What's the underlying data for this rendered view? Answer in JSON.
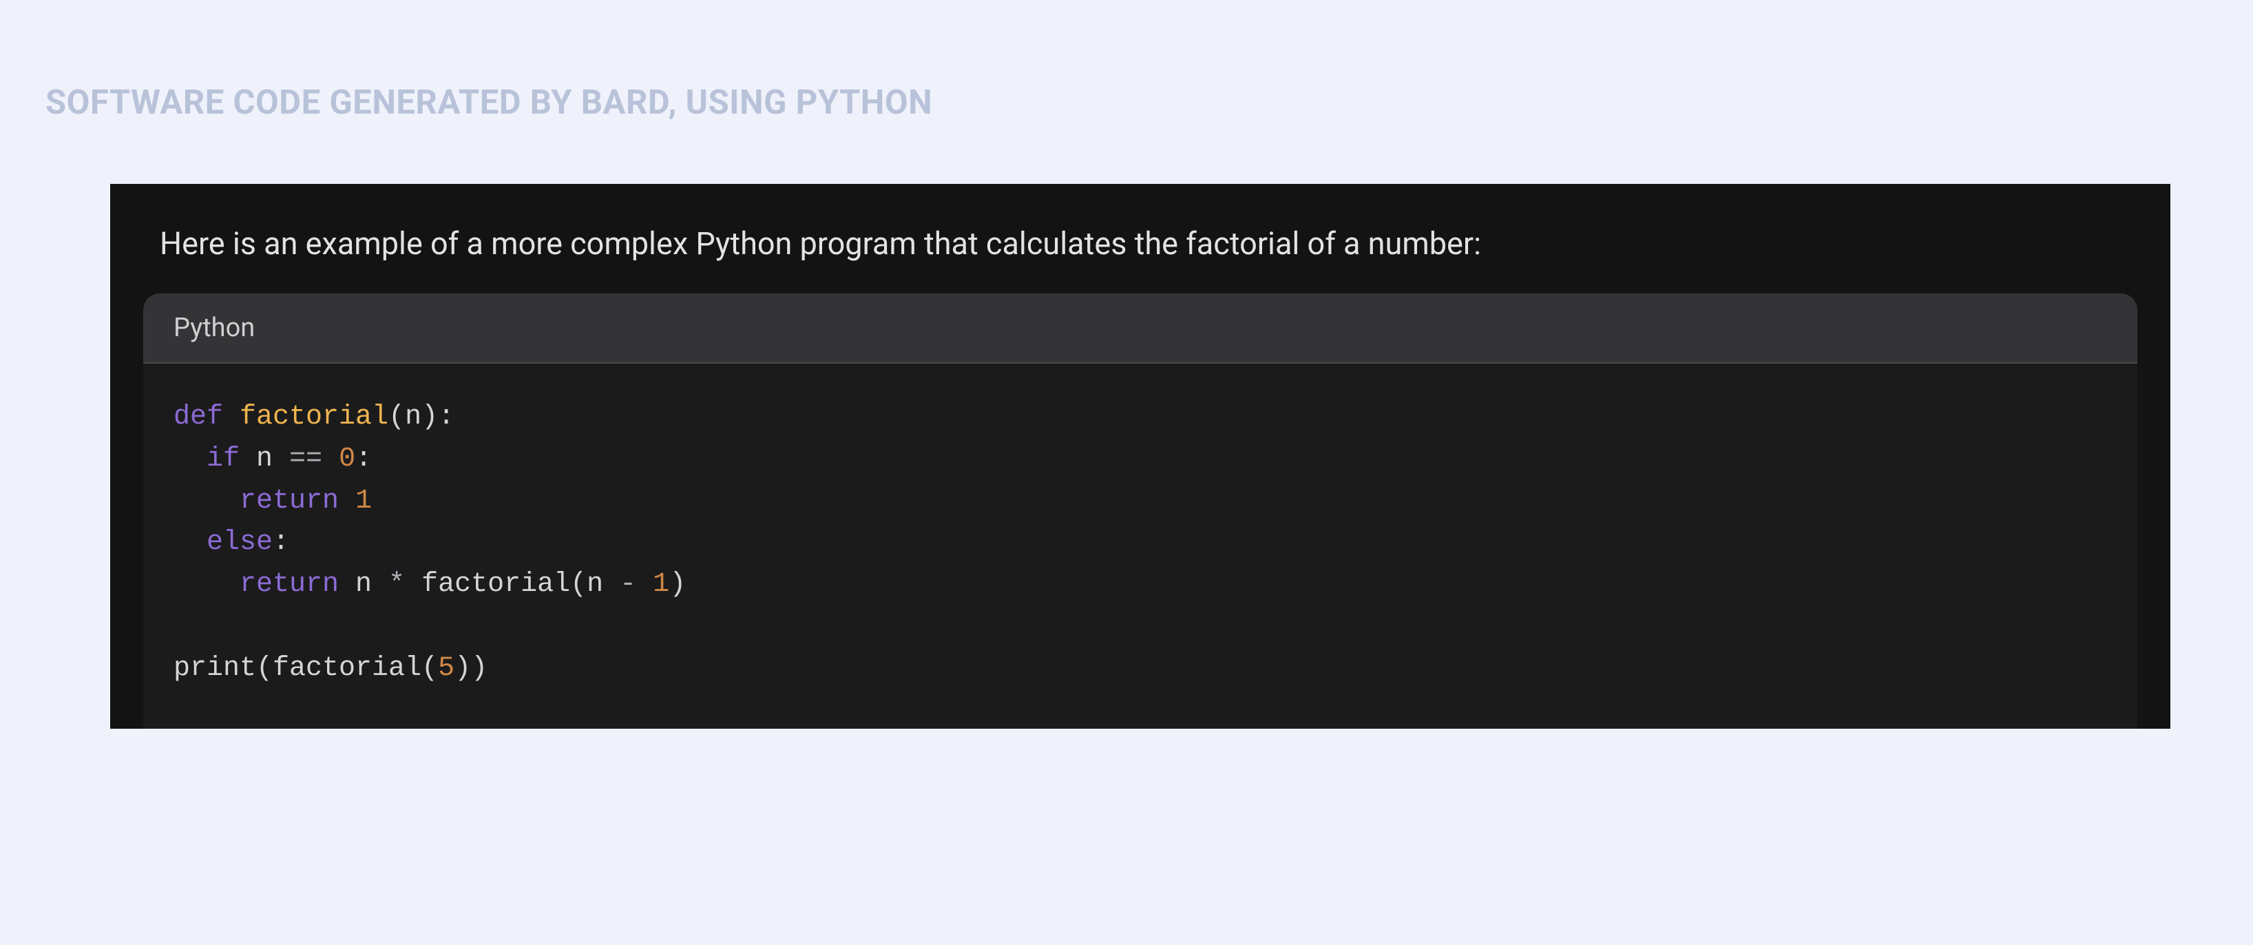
{
  "heading": "SOFTWARE CODE GENERATED BY BARD, USING PYTHON",
  "chat": {
    "intro": "Here is an example of a more complex Python program that calculates the factorial of a number:",
    "code_language": "Python",
    "code_tokens": [
      [
        {
          "cls": "tok-kw",
          "t": "def"
        },
        {
          "cls": "tok-id",
          "t": " "
        },
        {
          "cls": "tok-fn",
          "t": "factorial"
        },
        {
          "cls": "tok-par",
          "t": "(n):"
        }
      ],
      [
        {
          "cls": "tok-id",
          "t": "  "
        },
        {
          "cls": "tok-kw",
          "t": "if"
        },
        {
          "cls": "tok-id",
          "t": " n "
        },
        {
          "cls": "tok-op",
          "t": "=="
        },
        {
          "cls": "tok-id",
          "t": " "
        },
        {
          "cls": "tok-num",
          "t": "0"
        },
        {
          "cls": "tok-par",
          "t": ":"
        }
      ],
      [
        {
          "cls": "tok-id",
          "t": "    "
        },
        {
          "cls": "tok-kw",
          "t": "return"
        },
        {
          "cls": "tok-id",
          "t": " "
        },
        {
          "cls": "tok-num",
          "t": "1"
        }
      ],
      [
        {
          "cls": "tok-id",
          "t": "  "
        },
        {
          "cls": "tok-kw",
          "t": "else"
        },
        {
          "cls": "tok-par",
          "t": ":"
        }
      ],
      [
        {
          "cls": "tok-id",
          "t": "    "
        },
        {
          "cls": "tok-kw",
          "t": "return"
        },
        {
          "cls": "tok-id",
          "t": " n "
        },
        {
          "cls": "tok-op",
          "t": "*"
        },
        {
          "cls": "tok-id",
          "t": " factorial(n "
        },
        {
          "cls": "tok-op",
          "t": "-"
        },
        {
          "cls": "tok-id",
          "t": " "
        },
        {
          "cls": "tok-num",
          "t": "1"
        },
        {
          "cls": "tok-par",
          "t": ")"
        }
      ],
      [
        {
          "cls": null,
          "t": ""
        }
      ],
      [
        {
          "cls": "tok-id",
          "t": "print(factorial("
        },
        {
          "cls": "tok-num",
          "t": "5"
        },
        {
          "cls": "tok-par",
          "t": "))"
        }
      ]
    ]
  }
}
